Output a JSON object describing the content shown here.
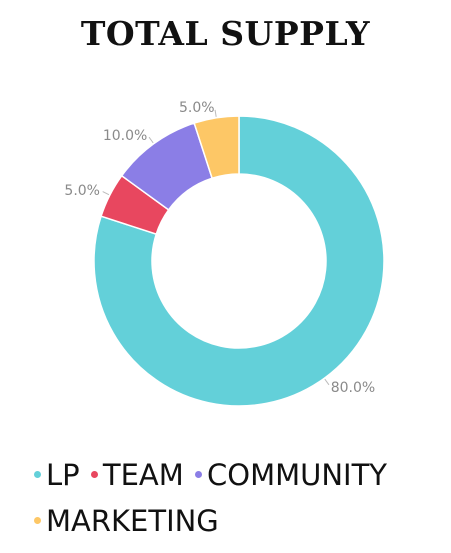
{
  "chart_data": {
    "type": "pie",
    "title": "TOTAL SUPPLY",
    "categories": [
      "LP",
      "TEAM",
      "COMMUNITY",
      "MARKETING"
    ],
    "values": [
      80.0,
      5.0,
      10.0,
      5.0
    ],
    "slice_labels": [
      "80.0%",
      "5.0%",
      "10.0%",
      "5.0%"
    ],
    "colors": [
      "#63d0d9",
      "#e8475f",
      "#8b7ee6",
      "#fdc766"
    ],
    "donut": true,
    "legend_position": "bottom"
  }
}
